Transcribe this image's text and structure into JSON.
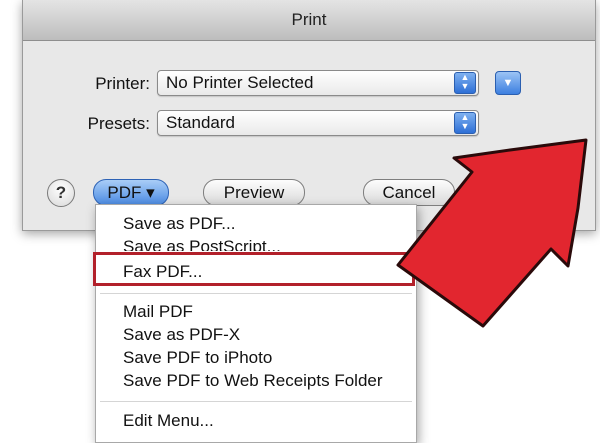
{
  "dialog": {
    "title": "Print",
    "printer_label": "Printer:",
    "printer_value": "No Printer Selected",
    "presets_label": "Presets:",
    "presets_value": "Standard"
  },
  "buttons": {
    "help": "?",
    "pdf": "PDF ▾",
    "preview": "Preview",
    "cancel": "Cancel"
  },
  "pdf_menu": {
    "items": [
      "Save as PDF...",
      "Save as PostScript...",
      "Fax PDF...",
      "Mail PDF",
      "Save as PDF-X",
      "Save PDF to iPhoto",
      "Save PDF to Web Receipts Folder",
      "Edit Menu..."
    ],
    "highlighted_item": "Fax PDF..."
  },
  "annotation": {
    "highlight_color": "#b2202a",
    "arrow_color": "#e2262f"
  },
  "icons": {
    "stepper": "up-down-arrows-icon",
    "disclosure": "triangle-down-icon",
    "help": "question-mark-icon",
    "annotation_arrow": "red-arrow-icon"
  }
}
